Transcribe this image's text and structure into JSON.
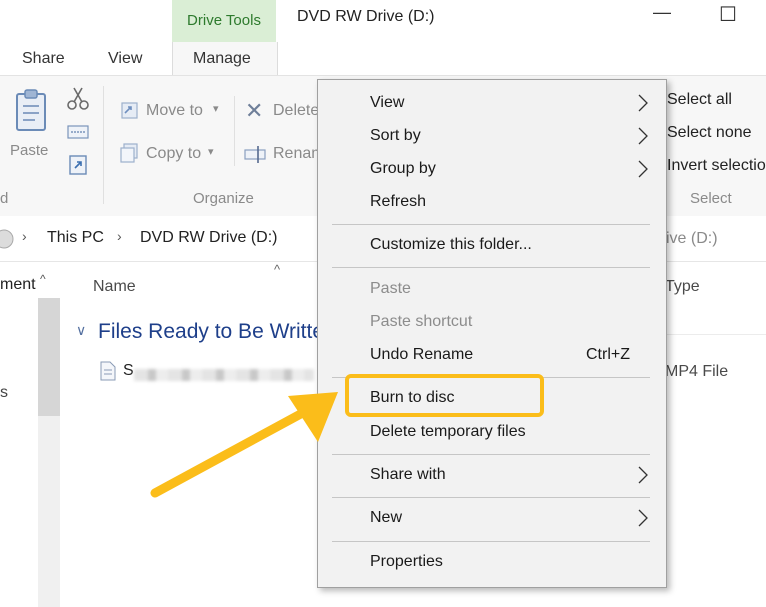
{
  "window": {
    "title": "DVD RW Drive (D:)",
    "minimize_glyph": "—",
    "maximize_glyph": "☐"
  },
  "ribbon": {
    "tabs": {
      "share": "Share",
      "view": "View",
      "contextual_group": "Drive Tools",
      "manage": "Manage"
    },
    "clipboard": {
      "paste": "Paste",
      "group_label_fragment": "d"
    },
    "organize": {
      "move_to": "Move to",
      "copy_to": "Copy to",
      "delete": "Delete",
      "rename": "Rename",
      "group_label": "Organize"
    },
    "select": {
      "select_all": "Select all",
      "select_none": "Select none",
      "invert_selection": "Invert selection",
      "group_label": "Select"
    }
  },
  "address_bar": {
    "crumb1": "This PC",
    "crumb2": "DVD RW Drive (D:)",
    "search_fragment": "ive (D:)"
  },
  "nav_pane": {
    "item_fragment": "ment",
    "extra_fragment": "s"
  },
  "file_list": {
    "col_name": "Name",
    "col_type": "Type",
    "group_header": "Files Ready to Be Written",
    "rows": [
      {
        "name_fragment": "S",
        "type": "MP4 File"
      }
    ]
  },
  "context_menu": {
    "items": [
      {
        "label": "View",
        "submenu": true,
        "disabled": false
      },
      {
        "label": "Sort by",
        "submenu": true,
        "disabled": false
      },
      {
        "label": "Group by",
        "submenu": true,
        "disabled": false
      },
      {
        "label": "Refresh",
        "submenu": false,
        "disabled": false
      },
      {
        "label": "Customize this folder...",
        "submenu": false,
        "disabled": false
      },
      {
        "label": "Paste",
        "submenu": false,
        "disabled": true
      },
      {
        "label": "Paste shortcut",
        "submenu": false,
        "disabled": true
      },
      {
        "label": "Undo Rename",
        "shortcut": "Ctrl+Z",
        "submenu": false,
        "disabled": false
      },
      {
        "label": "Burn to disc",
        "submenu": false,
        "disabled": false,
        "highlighted": true
      },
      {
        "label": "Delete temporary files",
        "submenu": false,
        "disabled": false
      },
      {
        "label": "Share with",
        "submenu": true,
        "disabled": false
      },
      {
        "label": "New",
        "submenu": true,
        "disabled": false
      },
      {
        "label": "Properties",
        "submenu": false,
        "disabled": false
      }
    ]
  },
  "colors": {
    "accent_highlight": "#fbbd1a",
    "contextual_tab": "#daeed5",
    "menu_bg": "#f2f2f2"
  }
}
